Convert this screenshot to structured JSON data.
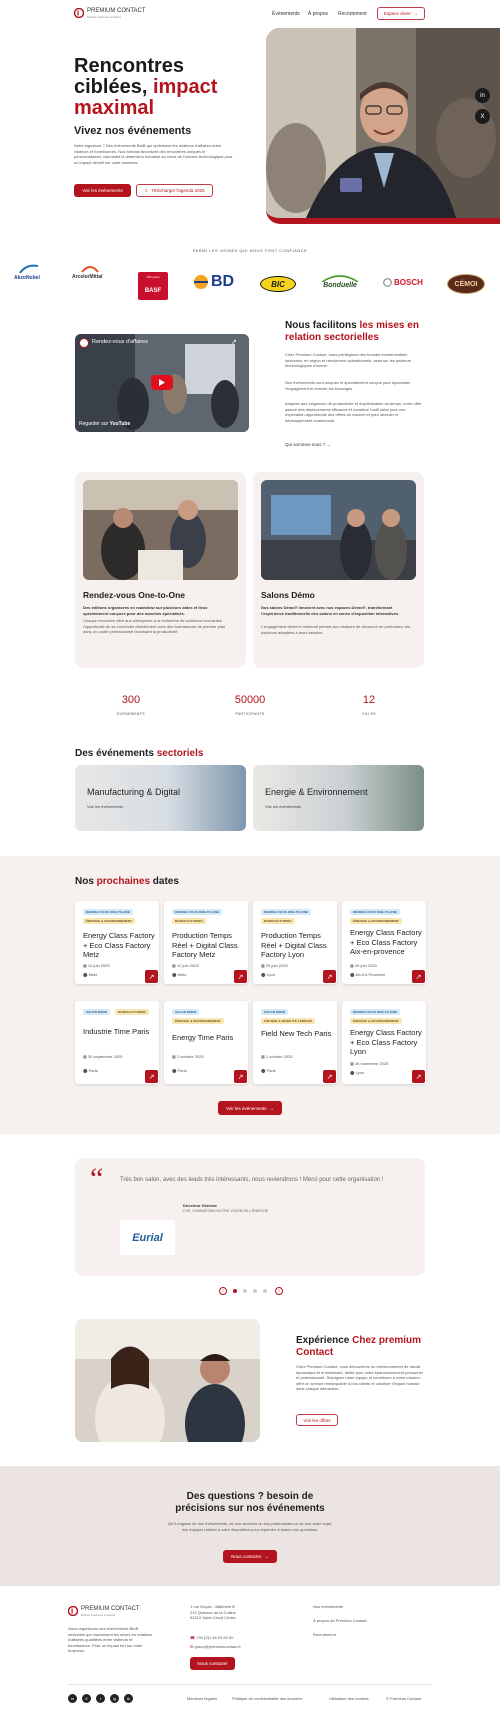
{
  "header": {
    "brand_name": "PREMIUM CONTACT",
    "brand_tagline": "Deliver business contacts",
    "nav": [
      "Événements",
      "À propos",
      "Recrutement"
    ],
    "client_space": "Espace client"
  },
  "hero": {
    "title_line1": "Rencontres",
    "title_line2a": "ciblées, ",
    "title_line2b": "impact",
    "title_line3": "maximal",
    "subtitle": "Vivez nos événements",
    "body": "Notre signature ? Des événements BtoB qui optimisent les relations d'affaires entre visiteurs et fournisseurs. Nos formats favorisent des rencontres uniques et personnalisées, valorisant la dimension humaine au cœur de l'univers technologique pour un impact décisif sur votre business.",
    "cta_primary": "Voir les événements",
    "cta_secondary": "Télécharger l'agenda 2025",
    "social": [
      "in",
      "X"
    ]
  },
  "trust": {
    "label": "PARMI LES USINES QUI NOUS FONT CONFIANCE",
    "logos": [
      "AkzoNobel",
      "ArcelorMittal",
      "BASF",
      "BD",
      "BIC",
      "Bonduelle",
      "BOSCH",
      "CÉMOI"
    ],
    "basf_badge": "150 years"
  },
  "about": {
    "video_title": "Rendez-vous d'affaires",
    "video_watch": "Regarder sur",
    "video_brand": "YouTube",
    "title_a": "Nous facilitons ",
    "title_b": "les mises en relation sectorielles",
    "p1": "Chez Premium Contact, nous privilégions des formats événementiels sectoriels, en région et résolument opérationnels, axés sur les secteurs technologiques d'avenir.",
    "p2": "Nos événements sont uniques et spécialement conçus pour dynamiser l'engagement et enrichir les échanges.",
    "p3": "Adaptés aux exigences de productivité et d'optimisation du temps, notre offre assure des déplacements efficaces et constitue l'outil idéal pour une exploration approfondie des offres du marché et pour stimuler le développement commercial.",
    "link": "Qui sommes-nous ?"
  },
  "formats": [
    {
      "title": "Rendez-vous One-to-One",
      "lead": "Des éditions organisées en roadshow sur plusieurs dates et lieux spécialement conçues pour des marchés spécialisés.",
      "body": "Chaque rencontre offre aux entreprises à la recherche de solutions innovantes l'opportunité de se connecter directement avec des fournisseurs de premier plan dans un cadre professionnel favorisant la productivité."
    },
    {
      "title": "Salons Démo",
      "lead": "Nos salons Démo® innovent avec nos espaces Démo®, transformant l'expérience traditionnelle des salons en zones d'exposition interactives.",
      "body": "L'engagement direct et immersif permet aux visiteurs de découvrir en profondeur les solutions adaptées à leurs besoins."
    }
  ],
  "stats": [
    {
      "value": "300",
      "label": "ÉVÉNEMENTS"
    },
    {
      "value": "50000",
      "label": "PARTICIPANTS"
    },
    {
      "value": "12",
      "label": "VILLES"
    }
  ],
  "sectors": {
    "title_a": "Des événements ",
    "title_b": "sectoriels",
    "items": [
      {
        "title": "Manufacturing & Digital",
        "link": "Voir les événements"
      },
      {
        "title": "Energie & Environnement",
        "link": "Voir les événements"
      }
    ]
  },
  "upcoming": {
    "title_a": "Nos ",
    "title_b": "prochaines",
    "title_c": " dates",
    "cta": "Voir les événements",
    "events": [
      {
        "tags": [
          "RENDEZ-VOUS ONE-TO-ONE",
          "ÉNERGIE & ENVIRONNEMENT"
        ],
        "title": "Energy Class Factory + Eco Class Factory Metz",
        "date": "12 juin 2025",
        "location": "Metz"
      },
      {
        "tags": [
          "RENDEZ-VOUS ONE-TO-ONE",
          "MANUFACTURING"
        ],
        "title": "Production Temps Réel + Digital Class Factory Metz",
        "date": "12 juin 2025",
        "location": "Metz"
      },
      {
        "tags": [
          "RENDEZ-VOUS ONE-TO-ONE",
          "MANUFACTURING"
        ],
        "title": "Production Temps Réel + Digital Class Factory Lyon",
        "date": "25 juin 2025",
        "location": "Lyon"
      },
      {
        "tags": [
          "RENDEZ-VOUS ONE-TO-ONE",
          "ÉNERGIE & ENVIRONNEMENT"
        ],
        "title": "Energy Class Factory + Eco Class Factory Aix-en-provence",
        "date": "26 juin 2025",
        "location": "Aix-En-Provence"
      },
      {
        "tags": [
          "SALON DÉMO",
          "MANUFACTURING"
        ],
        "title": "Industrie Time Paris",
        "date": "30 septembre 2025",
        "location": "Paris"
      },
      {
        "tags": [
          "SALON DÉMO",
          "ÉNERGIE & ENVIRONNEMENT"
        ],
        "title": "Energy Time Paris",
        "date": "2 octobre 2025",
        "location": "Paris"
      },
      {
        "tags": [
          "SALON DÉMO",
          "FIM WEB & MOBILITÉ TERRAIN"
        ],
        "title": "Field New Tech Paris",
        "date": "2 octobre 2025",
        "location": "Paris"
      },
      {
        "tags": [
          "RENDEZ-VOUS ONE-TO-ONE",
          "ÉNERGIE & ENVIRONNEMENT"
        ],
        "title": "Energy Class Factory + Eco Class Factory Lyon",
        "date": "26 novembre 2025",
        "location": "Lyon"
      }
    ]
  },
  "testimonial": {
    "quote": "Très bon salon, avec des leads très intéressants, nous reviendrons ! Merci pour cette organisation !",
    "author_role": "Directeur Général",
    "author_company": "CVE, CHANGEONS NOTRE VISION DE L'ÉNERGIE",
    "logo": "Eurial"
  },
  "experience": {
    "title_a": "Expérience ",
    "title_b": "Chez premium Contact",
    "body": "Chez Premium Contact, vous découvrirez un environnement de travail dynamique et enrichissant, dédié pour votre épanouissement personnel et professionnel. Rejoignez notre équipe et contribuez à notre mission : offrir un service remarquable à nos clients et valoriser l'impact humain dans chaque interaction.",
    "cta": "Voir les offres"
  },
  "faq": {
    "title1": "Des questions ? besoin de",
    "title2": "précisions sur nos événements",
    "body": "Qu'il s'agisse de nos événements, de nos services ou nos partenariats ou de tout autre sujet, nos équipes restent à votre disposition pour répondre à toutes vos questions.",
    "cta": "Nous contacter"
  },
  "footer": {
    "about": "Nous organisons des événements BtoB sectoriels qui maximisent les mises en relations d'affaires qualifiées entre visiteurs et fournisseurs. Pour un impact fort sur votre business.",
    "address1": "1 rue Doyan - Bâtiment B",
    "address2": "210 Quinaux de la Colline",
    "address3": "92210 Saint-Cloud Cedex",
    "phone": "+33 (0)1 46 23 60 00",
    "email": "group@premiumcontact.fr",
    "contact_cta": "Nous contacter",
    "links": [
      "Nos événements",
      "À propos de Premium Contact",
      "Recrutement"
    ],
    "social": [
      "in",
      "X",
      "f",
      "ig",
      "tk"
    ],
    "legal": [
      "Mentions légales",
      "Politique de confidentialité des données",
      "Utilisation des cookies",
      "© Premium Contact"
    ]
  },
  "colors": {
    "accent": "#b3141e",
    "soft_bg": "#f6f1ef",
    "faq_bg": "#ece4e2"
  }
}
